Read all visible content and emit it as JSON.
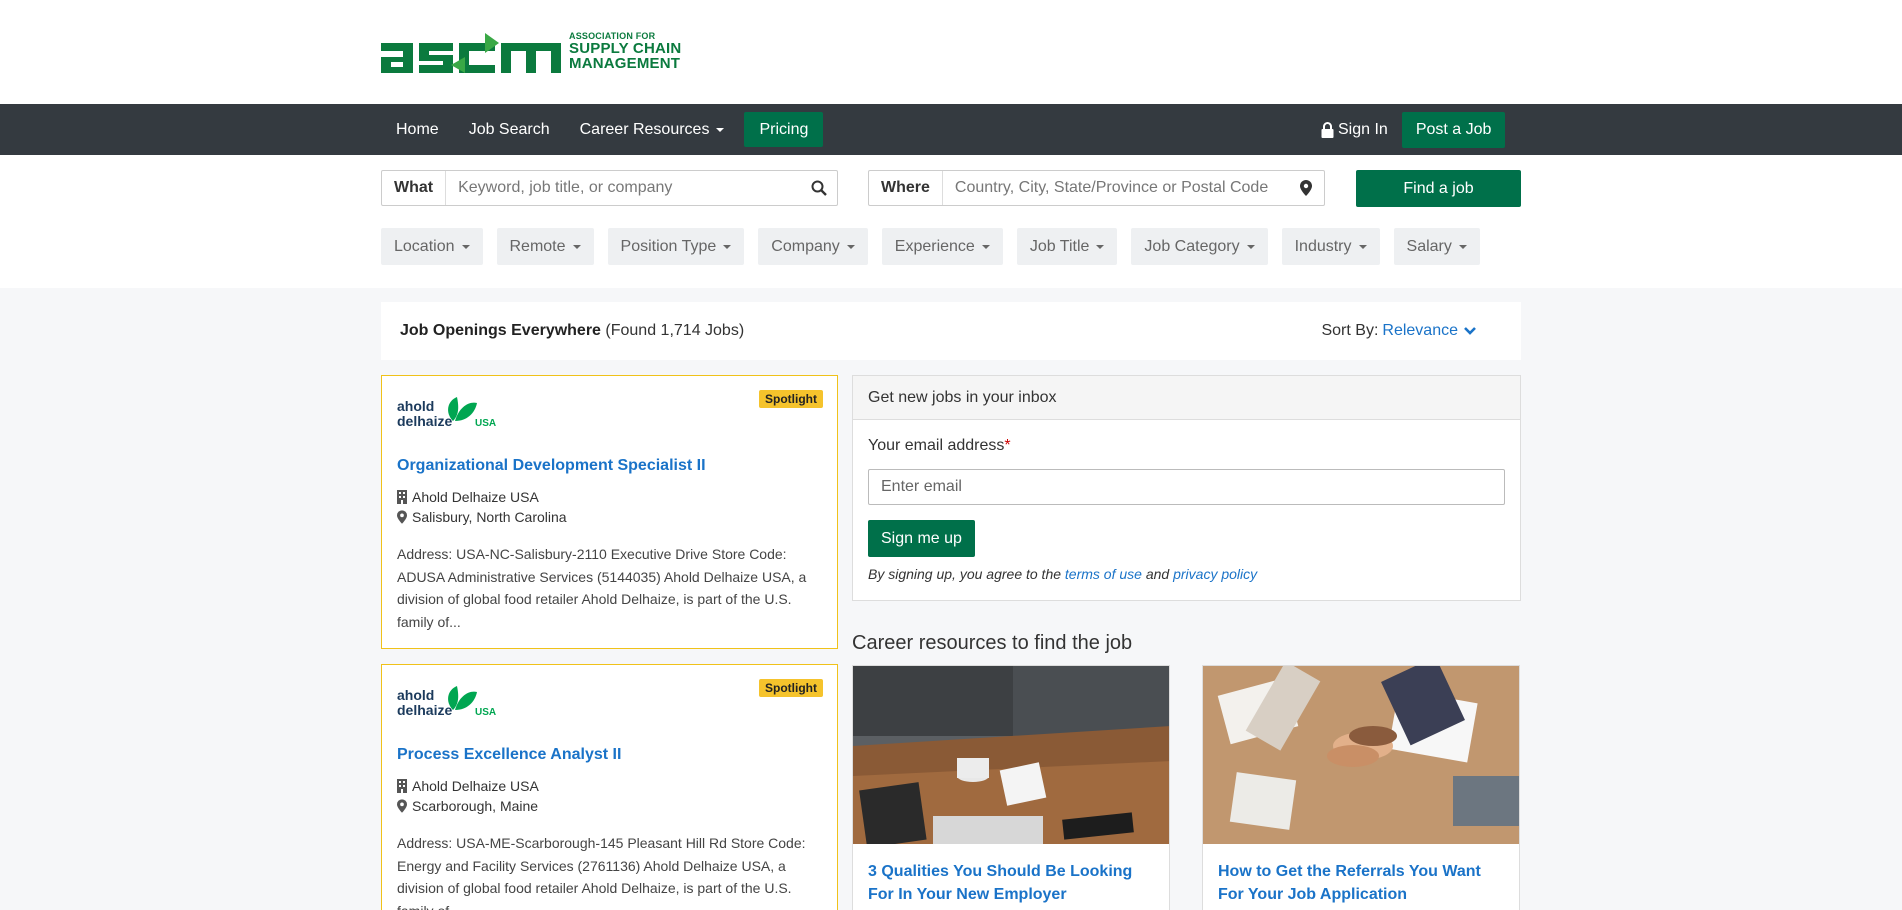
{
  "brand": {
    "logo_small": "ASSOCIATION FOR",
    "logo_line1": "SUPPLY CHAIN",
    "logo_line2": "MANAGEMENT",
    "color": "#0b7a3e"
  },
  "nav": {
    "items": [
      {
        "label": "Home"
      },
      {
        "label": "Job Search"
      },
      {
        "label": "Career Resources"
      },
      {
        "label": "Pricing"
      }
    ],
    "sign_in": "Sign In",
    "post_job": "Post a Job"
  },
  "search": {
    "what_label": "What",
    "what_placeholder": "Keyword, job title, or company",
    "where_label": "Where",
    "where_placeholder": "Country, City, State/Province or Postal Code",
    "find_button": "Find a job"
  },
  "filters": [
    {
      "label": "Location"
    },
    {
      "label": "Remote"
    },
    {
      "label": "Position Type"
    },
    {
      "label": "Company"
    },
    {
      "label": "Experience"
    },
    {
      "label": "Job Title"
    },
    {
      "label": "Job Category"
    },
    {
      "label": "Industry"
    },
    {
      "label": "Salary"
    }
  ],
  "results": {
    "title": "Job Openings Everywhere",
    "count": "(Found 1,714 Jobs)",
    "sort_label": "Sort By:",
    "sort_value": "Relevance"
  },
  "jobs": [
    {
      "badge": "Spotlight",
      "logo_text1": "ahold",
      "logo_text2": "delhaize",
      "logo_text3": "USA",
      "title": "Organizational Development Specialist II",
      "company": "Ahold Delhaize USA",
      "location": "Salisbury, North Carolina",
      "description": "Address: USA-NC-Salisbury-2110 Executive Drive Store Code: ADUSA Administrative Services (5144035) Ahold Delhaize USA, a division of global food retailer Ahold Delhaize, is part of the U.S. family of..."
    },
    {
      "badge": "Spotlight",
      "logo_text1": "ahold",
      "logo_text2": "delhaize",
      "logo_text3": "USA",
      "title": "Process Excellence Analyst II",
      "company": "Ahold Delhaize USA",
      "location": "Scarborough, Maine",
      "description": "Address: USA-ME-Scarborough-145 Pleasant Hill Rd Store Code: Energy and Facility Services (2761136) Ahold Delhaize USA, a division of global food retailer Ahold Delhaize, is part of the U.S. family of..."
    }
  ],
  "email_alert": {
    "heading": "Get new jobs in your inbox",
    "label": "Your email address",
    "required_mark": "*",
    "placeholder": "Enter email",
    "button": "Sign me up",
    "terms_prefix": "By signing up, you agree to the",
    "terms_link": "terms of use",
    "terms_and": "and",
    "privacy_link": "privacy policy"
  },
  "career_resources": {
    "heading": "Career resources to find the job",
    "items": [
      {
        "title": "3 Qualities You Should Be Looking For In Your New Employer"
      },
      {
        "title": "How to Get the Referrals You Want For Your Job Application"
      }
    ]
  },
  "colors": {
    "green": "#00704a",
    "nav_bg": "#343a40",
    "link": "#1a73c8",
    "spotlight": "#f5c32c"
  }
}
